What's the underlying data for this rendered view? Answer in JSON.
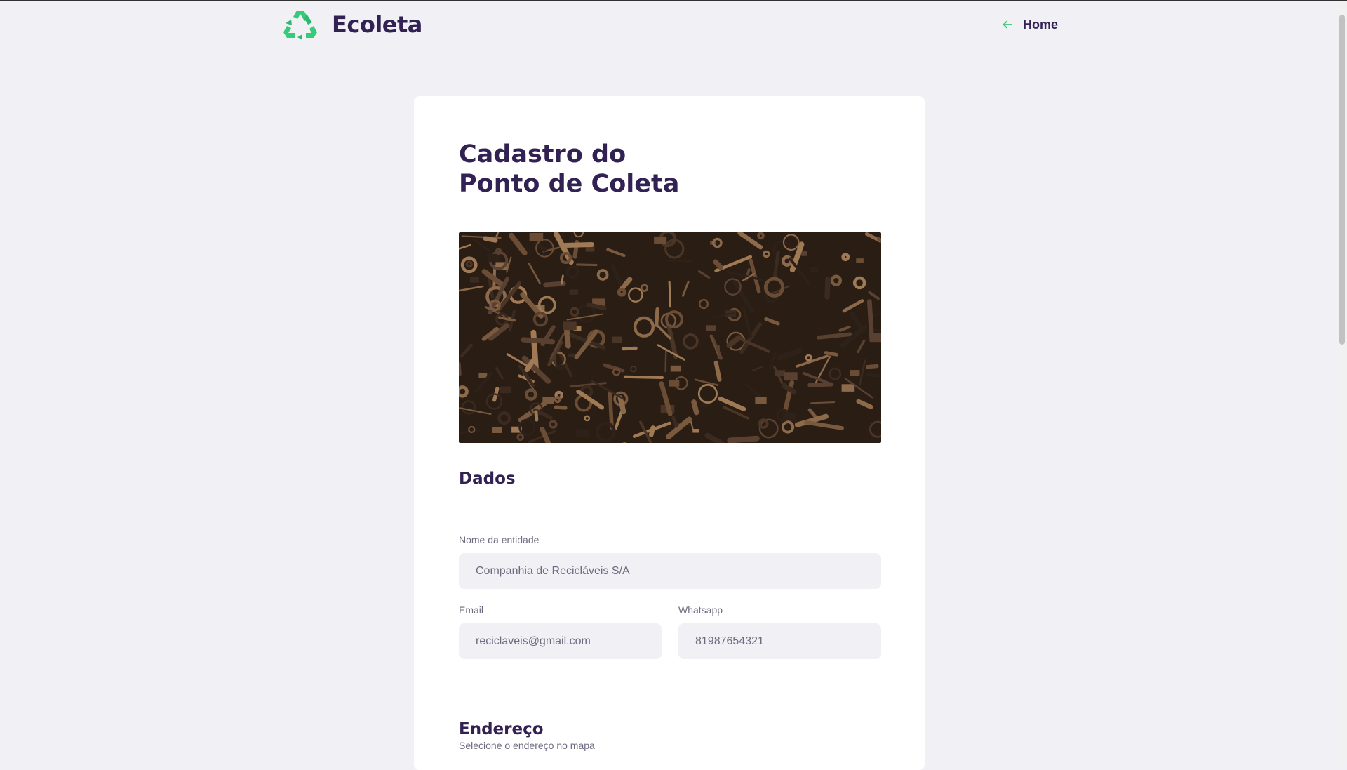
{
  "header": {
    "logo_text": "Ecoleta",
    "home_link": "Home",
    "logo_icon": "recycle-icon",
    "back_icon": "arrow-left-icon"
  },
  "form": {
    "title_line1": "Cadastro do",
    "title_line2": "Ponto de Coleta",
    "image_description": "pile of rusty metal scrap"
  },
  "dados": {
    "section_title": "Dados",
    "name_label": "Nome da entidade",
    "name_value": "Companhia de Recicláveis S/A",
    "email_label": "Email",
    "email_value": "reciclaveis@gmail.com",
    "whatsapp_label": "Whatsapp",
    "whatsapp_value": "81987654321"
  },
  "endereco": {
    "section_title": "Endereço",
    "hint": "Selecione o endereço no mapa"
  },
  "colors": {
    "brand": "#322153",
    "accent": "#34cb79",
    "background": "#f0f0f5",
    "text_muted": "#6c6c80"
  }
}
